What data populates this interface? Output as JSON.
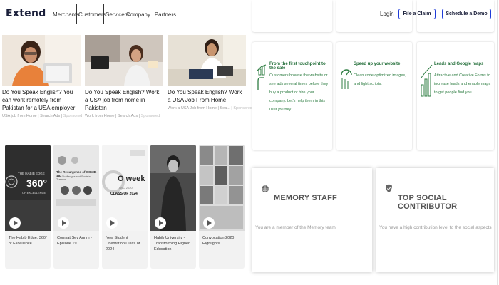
{
  "header": {
    "logo": "Extend",
    "nav": [
      "Merchants",
      "Customers",
      "Servicers",
      "Company",
      "Partners"
    ],
    "login": "Login",
    "claim_button": "File a Claim",
    "demo_button": "Schedule a Demo"
  },
  "articles": [
    {
      "title": "Do You Speak English? You can work remotely from Pakistan for a USA employer",
      "source": "USA job from Home",
      "sep": " | ",
      "ads": "Search Ads",
      "sponsored": "Sponsored"
    },
    {
      "title": "Do You Speak English? Work a USA job from home in Pakistan",
      "source": "Work from Home",
      "sep": " | ",
      "ads": "Search Ads",
      "sponsored": "Sponsored"
    },
    {
      "title": "Do You Speak English? Work a USA Job From Home",
      "source": "Work a USA Job from Home | Sea...",
      "sep": " | ",
      "ads": "",
      "sponsored": "Sponsored"
    }
  ],
  "videos": [
    {
      "caption": "The Habib Edge: 360° of Excellence",
      "thumb_title": "THE HABIB EDGE",
      "thumb_big": "360°",
      "thumb_sub": "OF EXCELLENCE"
    },
    {
      "caption": "Comsat Sey Agrim - Episode 19",
      "thumb_title": "The Resurgence of COVID-19:",
      "thumb_sub": "The Challenges and Societal Trauma"
    },
    {
      "caption": "New Student Orientation Class of 2024",
      "thumb_big": "O week",
      "thumb_sub": "NSO 2020",
      "thumb_class": "CLASS OF 2024"
    },
    {
      "caption": "Habib University - Transforming Higher Education"
    },
    {
      "caption": "Convocation 2020 Highlights"
    }
  ],
  "features": [
    {
      "title": "From the first touchpoint to the sale",
      "text": "Customers browse the website or see ads several times before they buy a product or hire your company. Let's help them in this user journey.",
      "icon": "growth-hand-icon"
    },
    {
      "title": "Speed up your website",
      "text": "Clean code optimized images, and light scripts.",
      "icon": "speed-gauge-icon"
    },
    {
      "title": "Leads and Google maps",
      "text": "Attractive and Creative Forms to increase leads and enable maps to get people find you.",
      "icon": "bar-chart-icon"
    }
  ],
  "badges": [
    {
      "title": "MEMORY STAFF",
      "text": "You are a member of the Memory team",
      "icon": "globe-badge-icon"
    },
    {
      "title": "TOP SOCIAL CONTRIBUTOR",
      "text": "You have a high contribution level to the social aspects",
      "icon": "shield-check-icon"
    }
  ],
  "colors": {
    "accent_blue": "#1e3bd8",
    "feature_green": "#2e7d42",
    "logo_navy": "#1a1f3a"
  }
}
